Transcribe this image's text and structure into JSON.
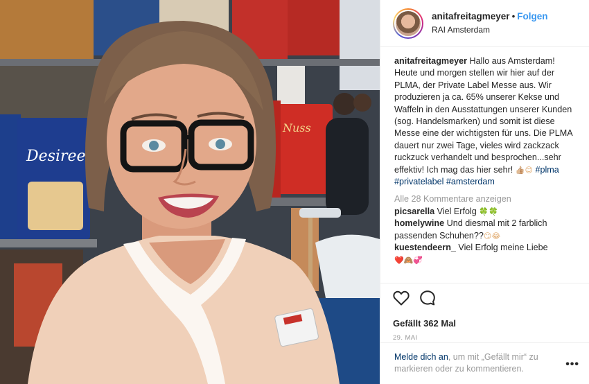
{
  "post": {
    "username": "anitafreitagmeyer",
    "follow_label": "Folgen",
    "location": "RAI Amsterdam",
    "caption_user": "anitafreitagmeyer",
    "caption_text": "Hallo aus Amsterdam! Heute und morgen stellen wir hier auf der PLMA, der Private Label Messe aus. Wir produzieren ja ca. 65% unserer Kekse und Waffeln in den Ausstattungen unserer Kunden (sog. Handelsmarken) und somit ist diese Messe eine der wichtigsten für uns. Die PLMA dauert nur zwei Tage, vieles wird zackzack ruckzuck verhandelt und besprochen...sehr effektiv! Ich mag das hier sehr!",
    "caption_emojis": "👍🏼😊",
    "hashtags": [
      "#plma",
      "#privatelabel",
      "#amsterdam"
    ],
    "view_comments": "Alle 28 Kommentare anzeigen",
    "likes": "Gefällt 362 Mal",
    "date": "29. MAI"
  },
  "comments": [
    {
      "user": "picsarella",
      "text": "Viel Erfolg",
      "emoji": "🍀🍀"
    },
    {
      "user": "homelywine",
      "text": "Und diesmal mit 2 farblich passenden Schuhen??",
      "emoji": "😏😂"
    },
    {
      "user": "kuestendeern_",
      "text": "Viel Erfolg meine Liebe",
      "emoji": "❤️🙈💞"
    }
  ],
  "footer": {
    "login_link": "Melde dich an",
    "rest_text": ", um mit „Gefällt mir“ zu markieren oder zu kommentieren.",
    "more_label": "•••"
  },
  "icons": {
    "like": "heart-outline",
    "comment": "speech-bubble-outline",
    "more": "ellipsis"
  },
  "colors": {
    "link_blue": "#3897f0",
    "hashtag_blue": "#003569",
    "muted_text": "#999999",
    "border": "#efefef"
  }
}
